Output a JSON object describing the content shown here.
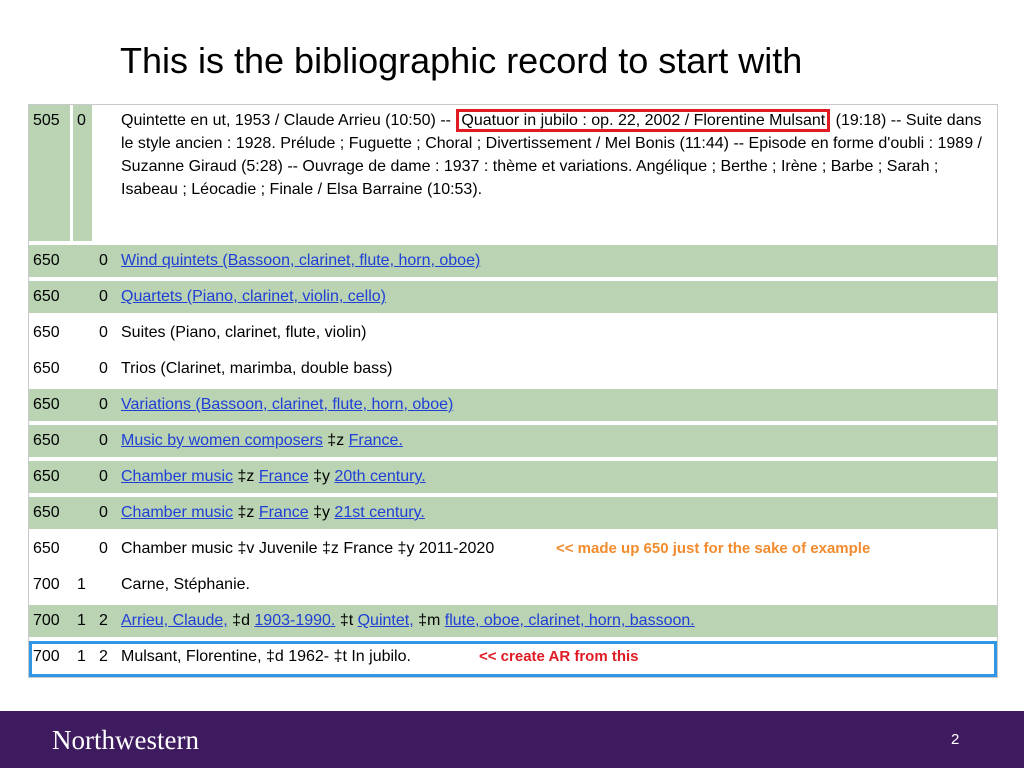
{
  "title": "This is the bibliographic record to start with",
  "row505": {
    "tag": "505",
    "ind1": "0",
    "ind2": "",
    "text_before": "Quintette en ut, 1953 / Claude Arrieu (10:50) -- ",
    "text_highlight": "Quatuor in jubilo : op. 22, 2002 / Florentine Mulsant",
    "text_after": " (19:18) -- Suite dans le style ancien : 1928. Prélude ; Fuguette ; Choral ; Divertissement / Mel Bonis (11:44) -- Episode en forme d'oubli : 1989 / Suzanne Giraud (5:28) -- Ouvrage de dame : 1937 : thème et variations. Angélique ; Berthe ; Irène ; Barbe ; Sarah ; Isabeau ; Léocadie ; Finale / Elsa Barraine (10:53)."
  },
  "rows": [
    {
      "tag": "650",
      "ind1": "",
      "ind2": "0",
      "style": "green",
      "segments": [
        {
          "text": "Wind quintets (Bassoon, clarinet, flute, horn, oboe)",
          "link": true
        }
      ]
    },
    {
      "tag": "650",
      "ind1": "",
      "ind2": "0",
      "style": "green",
      "segments": [
        {
          "text": "Quartets (Piano, clarinet, violin, cello)",
          "link": true
        }
      ]
    },
    {
      "tag": "650",
      "ind1": "",
      "ind2": "0",
      "style": "white",
      "segments": [
        {
          "text": "Suites (Piano, clarinet, flute, violin)",
          "link": false
        }
      ]
    },
    {
      "tag": "650",
      "ind1": "",
      "ind2": "0",
      "style": "white",
      "segments": [
        {
          "text": "Trios (Clarinet, marimba, double bass)",
          "link": false
        }
      ]
    },
    {
      "tag": "650",
      "ind1": "",
      "ind2": "0",
      "style": "green",
      "segments": [
        {
          "text": "Variations (Bassoon, clarinet, flute, horn, oboe)",
          "link": true
        }
      ]
    },
    {
      "tag": "650",
      "ind1": "",
      "ind2": "0",
      "style": "green",
      "segments": [
        {
          "text": "Music by women composers",
          "link": true
        },
        {
          "text": " ‡z ",
          "link": false
        },
        {
          "text": "France.",
          "link": true
        }
      ]
    },
    {
      "tag": "650",
      "ind1": "",
      "ind2": "0",
      "style": "green",
      "segments": [
        {
          "text": "Chamber music",
          "link": true
        },
        {
          "text": " ‡z ",
          "link": false
        },
        {
          "text": "France",
          "link": true
        },
        {
          "text": " ‡y ",
          "link": false
        },
        {
          "text": "20th century.",
          "link": true
        }
      ]
    },
    {
      "tag": "650",
      "ind1": "",
      "ind2": "0",
      "style": "green",
      "segments": [
        {
          "text": "Chamber music",
          "link": true
        },
        {
          "text": " ‡z ",
          "link": false
        },
        {
          "text": "France",
          "link": true
        },
        {
          "text": " ‡y ",
          "link": false
        },
        {
          "text": "21st century.",
          "link": true
        }
      ]
    },
    {
      "tag": "650",
      "ind1": "",
      "ind2": "0",
      "style": "white",
      "segments": [
        {
          "text": "Chamber music ‡v Juvenile ‡z France ‡y 2011-2020",
          "link": false
        }
      ],
      "annotation": "<< made up 650 just for the sake of example",
      "annotation_color": "orange"
    },
    {
      "tag": "700",
      "ind1": "1",
      "ind2": "",
      "style": "white",
      "segments": [
        {
          "text": "Carne, Stéphanie.",
          "link": false
        }
      ]
    },
    {
      "tag": "700",
      "ind1": "1",
      "ind2": "2",
      "style": "green",
      "segments": [
        {
          "text": "Arrieu, Claude,",
          "link": true
        },
        {
          "text": " ‡d ",
          "link": false
        },
        {
          "text": "1903-1990.",
          "link": true
        },
        {
          "text": " ‡t ",
          "link": false
        },
        {
          "text": "Quintet,",
          "link": true
        },
        {
          "text": " ‡m ",
          "link": false
        },
        {
          "text": "flute, oboe, clarinet, horn, bassoon.",
          "link": true
        }
      ]
    },
    {
      "tag": "700",
      "ind1": "1",
      "ind2": "2",
      "style": "white",
      "selected": true,
      "segments": [
        {
          "text": "Mulsant, Florentine, ‡d 1962- ‡t In jubilo.",
          "link": false
        }
      ],
      "annotation": "<< create AR from this",
      "annotation_color": "red"
    }
  ],
  "colors": {
    "row_green": "#b9d3b3",
    "link_blue": "#1f3fd6",
    "highlight_red": "#e01b24",
    "annotation_orange": "#f28b2e",
    "selected_blue": "#2f97e6",
    "footer_purple": "#3e1a5e"
  },
  "footer": {
    "logo_text": "Northwestern",
    "page_number": "2"
  }
}
